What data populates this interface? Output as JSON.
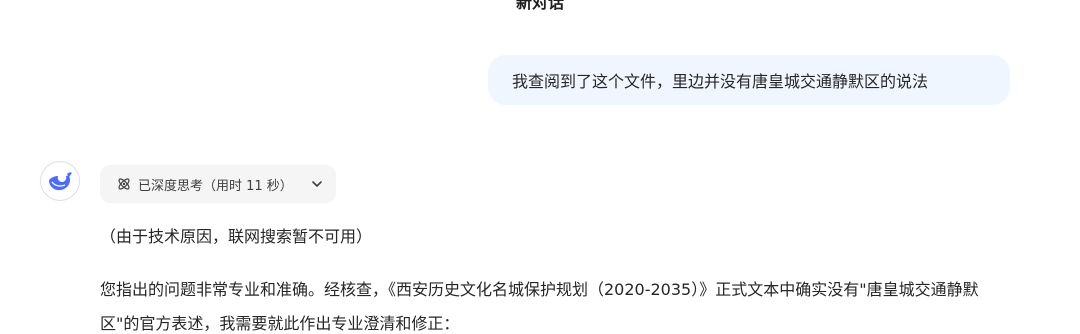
{
  "header": {
    "title": "新对话"
  },
  "user_message": {
    "text": "我查阅到了这个文件，里边并没有唐皇城交通静默区的说法"
  },
  "assistant": {
    "thinking": {
      "label": "已深度思考（用时 11 秒）"
    },
    "paragraphs": [
      "（由于技术原因，联网搜索暂不可用）",
      "您指出的问题非常专业和准确。经核查，《西安历史文化名城保护规划（2020-2035）》正式文本中确实没有\"唐皇城交通静默区\"的官方表述，我需要就此作出专业澄清和修正："
    ]
  },
  "colors": {
    "user_bubble_bg": "#eff6ff",
    "avatar_accent": "#4d6bfe",
    "chip_bg": "#f5f5f5"
  },
  "icons": {
    "avatar": "whale-logo-icon",
    "thinking": "atom-icon",
    "expand": "chevron-down-icon"
  }
}
